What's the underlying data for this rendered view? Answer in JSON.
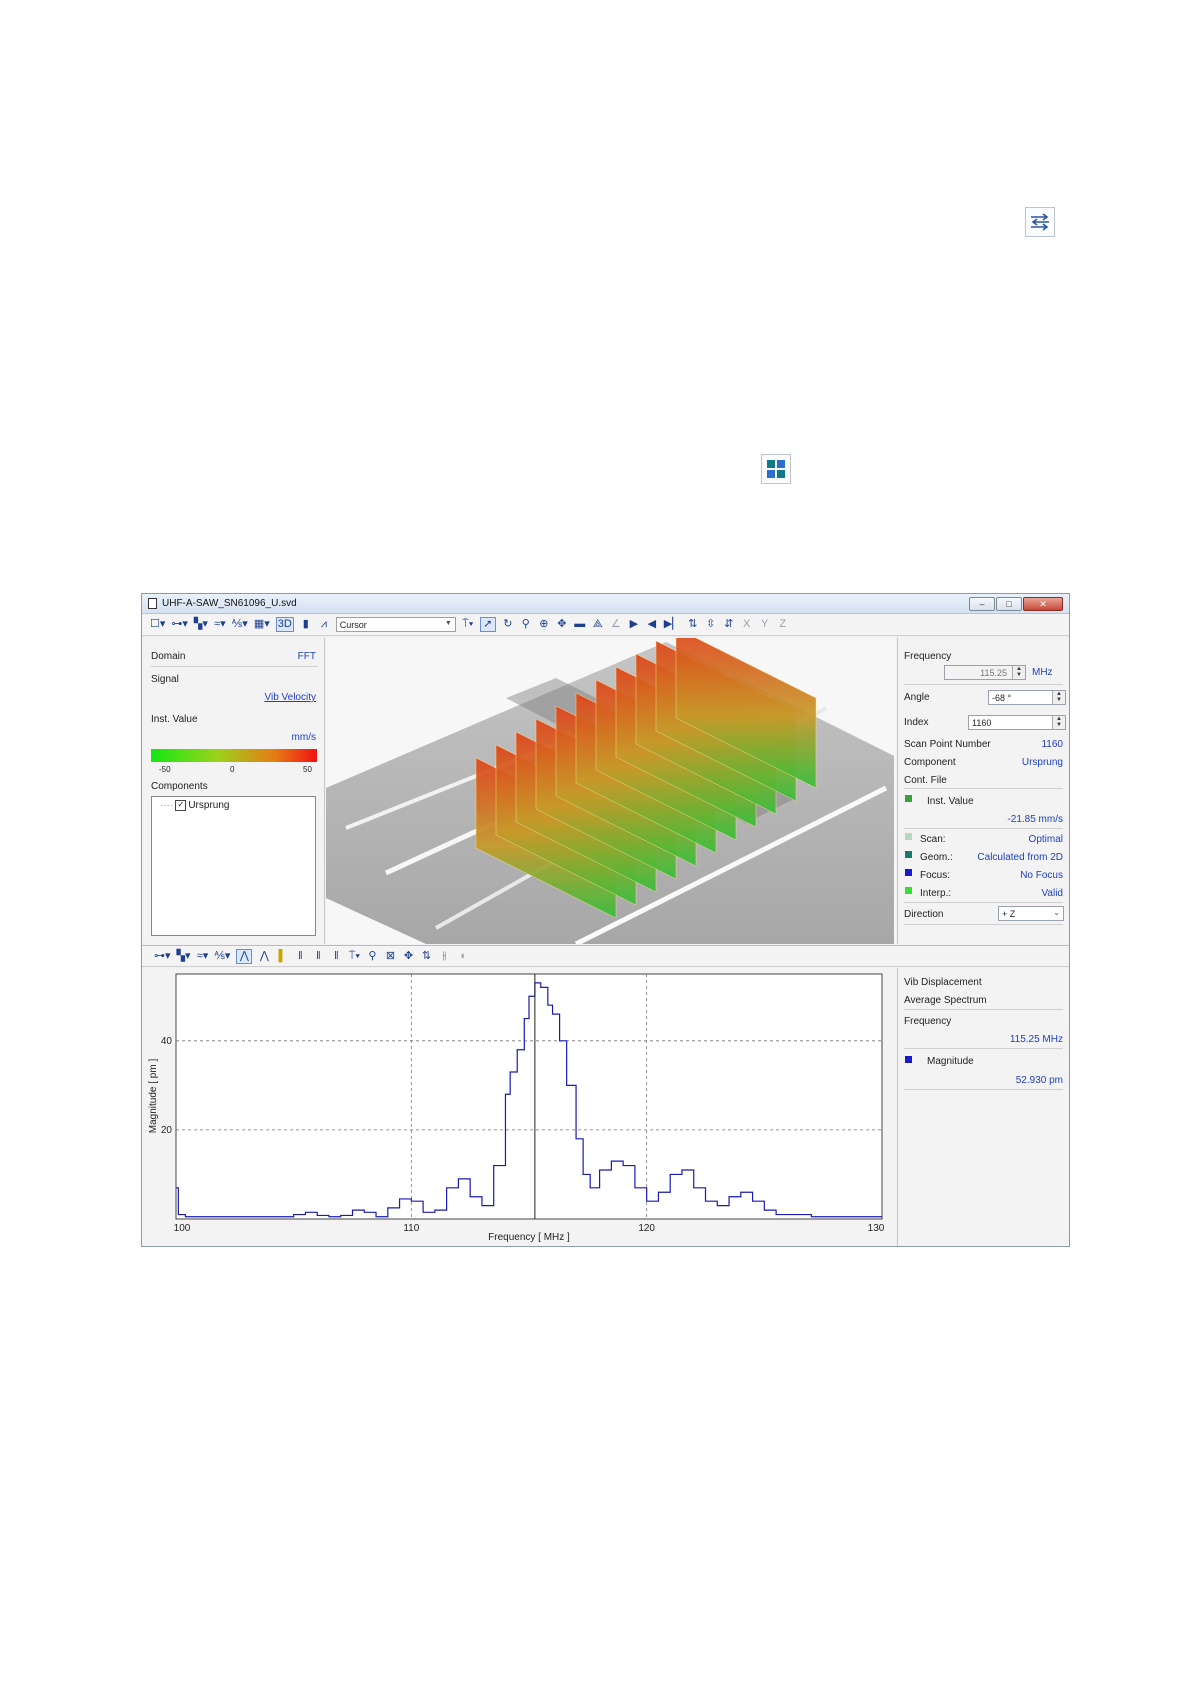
{
  "page_icons": [
    {
      "name": "swap-arrows-icon"
    },
    {
      "name": "quad-view-icon"
    }
  ],
  "window": {
    "title": "UHF-A-SAW_SN61096_U.svd",
    "controls": {
      "minimize": "–",
      "maximize": "□",
      "close": "✕"
    }
  },
  "toolbar": {
    "cursor_combo": "Cursor",
    "btn_3d": "3D",
    "axis_x": "X",
    "axis_y": "Y",
    "axis_z": "Z"
  },
  "left_panel": {
    "domain_label": "Domain",
    "domain_value": "FFT",
    "signal_label": "Signal",
    "signal_value": "Vib Velocity",
    "inst_label": "Inst. Value",
    "inst_unit": "mm/s",
    "scale_ticks": [
      "-50",
      "0",
      "50"
    ],
    "components_label": "Components",
    "component_item": "Ursprung"
  },
  "right_panel": {
    "frequency_label": "Frequency",
    "frequency_value": "115.25",
    "frequency_unit": "MHz",
    "angle_label": "Angle",
    "angle_value": "-68 °",
    "index_label": "Index",
    "index_value": "1160",
    "scan_point_label": "Scan Point Number",
    "scan_point_value": "1160",
    "component_label": "Component",
    "component_value": "Ursprung",
    "cont_file_label": "Cont. File",
    "inst_value_label": "Inst. Value",
    "inst_value_value": "-21.85 mm/s",
    "scan_label": "Scan:",
    "scan_value": "Optimal",
    "geom_label": "Geom.:",
    "geom_value": "Calculated from 2D",
    "focus_label": "Focus:",
    "focus_value": "No Focus",
    "interp_label": "Interp.:",
    "interp_value": "Valid",
    "direction_label": "Direction",
    "direction_value": "+ Z",
    "colors": {
      "inst": "#3aa13a",
      "scan": "#b8d8c0",
      "geom": "#1a7a6a",
      "focus": "#1a1acc",
      "interp": "#33dd33"
    }
  },
  "spectrum_info": {
    "line1": "Vib Displacement",
    "line2": "Average Spectrum",
    "frequency_label": "Frequency",
    "frequency_value": "115.25 MHz",
    "magnitude_label": "Magnitude",
    "magnitude_value": "52.930 pm",
    "magnitude_color": "#1a1acc"
  },
  "chart_data": {
    "type": "line",
    "title": "",
    "xlabel": "Frequency [ MHz ]",
    "ylabel": "Magnitude [ pm ]",
    "xlim": [
      100,
      130
    ],
    "ylim": [
      0,
      55
    ],
    "xticks": [
      100,
      110,
      120,
      130
    ],
    "yticks": [
      20,
      40
    ],
    "grid": "dashed",
    "cursor_x": 115.25,
    "series": [
      {
        "color": "#1a1ab0",
        "x": [
          100,
          100.1,
          100.4,
          101,
          102,
          103,
          104,
          105,
          105.5,
          106,
          106.5,
          107,
          107.5,
          108,
          108.5,
          109,
          109.5,
          110,
          110.5,
          111,
          111.5,
          112,
          112.5,
          113,
          113.5,
          114,
          114.2,
          114.5,
          114.8,
          115,
          115.25,
          115.5,
          115.8,
          116,
          116.3,
          116.6,
          117,
          117.3,
          117.6,
          118,
          118.5,
          119,
          119.5,
          120,
          120.5,
          121,
          121.5,
          122,
          122.5,
          123,
          123.5,
          124,
          124.5,
          125,
          125.5,
          126,
          127,
          128,
          129,
          130
        ],
        "y": [
          7,
          1,
          0.5,
          0.5,
          0.5,
          0.5,
          0.5,
          1,
          1.5,
          0.8,
          0.5,
          0.8,
          2,
          1.5,
          0.5,
          2.5,
          4.5,
          4,
          1.5,
          2,
          7,
          9,
          5,
          3,
          12,
          28,
          33,
          38,
          45,
          50,
          53,
          52,
          48,
          46,
          40,
          30,
          18,
          10,
          7,
          11,
          13,
          12,
          7,
          4,
          6,
          10,
          11,
          7,
          4,
          3,
          5,
          6,
          4,
          2,
          1,
          1,
          0.5,
          0.5,
          0.5,
          0.5
        ]
      }
    ]
  }
}
